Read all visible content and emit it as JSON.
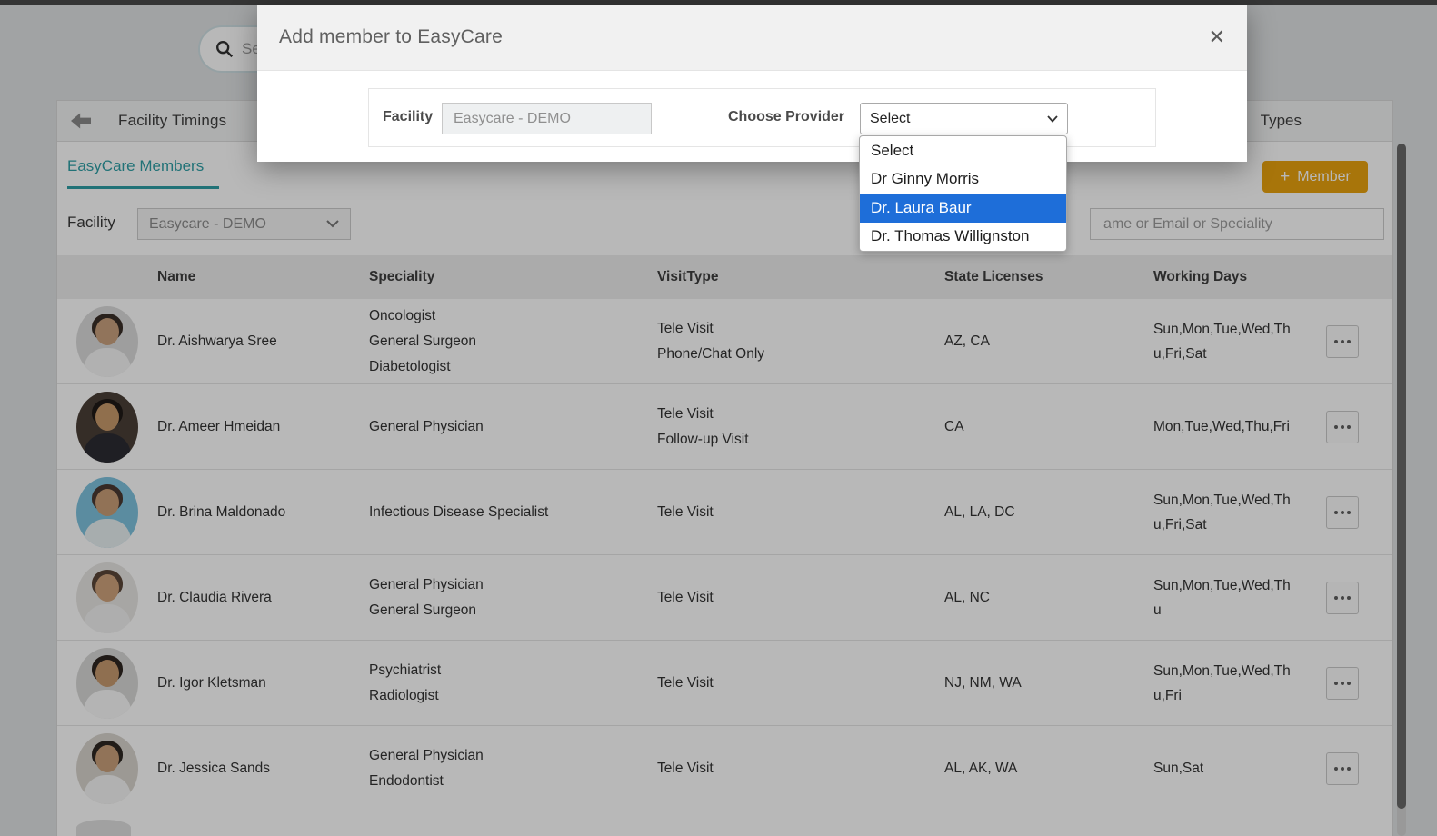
{
  "page": {
    "top_search": {
      "placeholder_visible": "Se"
    },
    "panel": {
      "back_icon": "left-arrow",
      "title": "Facility Timings",
      "right_text": "Types",
      "tab": "EasyCare Members",
      "member_button": {
        "plus": "+",
        "label": "Member",
        "color": "#e9a20f"
      },
      "facility_filter": {
        "label": "Facility",
        "value": "Easycare - DEMO"
      },
      "member_search": {
        "placeholder_visible": "ame or Email or Speciality"
      },
      "accent_teal": "#2f9fa5"
    },
    "table": {
      "headers": [
        "Name",
        "Speciality",
        "VisitType",
        "State Licenses",
        "Working Days"
      ],
      "row_action_icon": "ellipsis",
      "rows": [
        {
          "name": "Dr. Aishwarya Sree",
          "specialities": [
            "Oncologist",
            "General Surgeon",
            "Diabetologist"
          ],
          "visit_types": [
            "Tele Visit",
            "Phone/Chat Only"
          ],
          "state_licenses": "AZ, CA",
          "working_days": "Sun,Mon,Tue,Wed,Thu,Fri,Sat",
          "avatar": {
            "bg": "#dcdcdc",
            "hair": "#3a2e28",
            "skin": "#caa17e",
            "coat": "#f5f5f5"
          }
        },
        {
          "name": "Dr. Ameer Hmeidan",
          "specialities": [
            "General Physician"
          ],
          "visit_types": [
            "Tele Visit",
            "Follow-up Visit"
          ],
          "state_licenses": "CA",
          "working_days": "Mon,Tue,Wed,Thu,Fri",
          "avatar": {
            "bg": "#4a3f36",
            "hair": "#1f1a17",
            "skin": "#c89a6b",
            "coat": "#2b2b33"
          }
        },
        {
          "name": "Dr. Brina Maldonado",
          "specialities": [
            "Infectious Disease Specialist"
          ],
          "visit_types": [
            "Tele Visit"
          ],
          "state_licenses": "AL, LA, DC",
          "working_days": "Sun,Mon,Tue,Wed,Thu,Fri,Sat",
          "avatar": {
            "bg": "#7ec3de",
            "hair": "#4a3a32",
            "skin": "#c99f78",
            "coat": "#e8f0f2"
          }
        },
        {
          "name": "Dr. Claudia Rivera",
          "specialities": [
            "General Physician",
            "General Surgeon"
          ],
          "visit_types": [
            "Tele Visit"
          ],
          "state_licenses": "AL, NC",
          "working_days": "Sun,Mon,Tue,Wed,Thu",
          "avatar": {
            "bg": "#e8e6e3",
            "hair": "#5a4638",
            "skin": "#cfa27c",
            "coat": "#f2f2f2"
          }
        },
        {
          "name": "Dr. Igor Kletsman",
          "specialities": [
            "Psychiatrist",
            "Radiologist"
          ],
          "visit_types": [
            "Tele Visit"
          ],
          "state_licenses": "NJ, NM, WA",
          "working_days": "Sun,Mon,Tue,Wed,Thu,Fri",
          "avatar": {
            "bg": "#d9d9d7",
            "hair": "#2e2620",
            "skin": "#c79a70",
            "coat": "#fafafa"
          }
        },
        {
          "name": "Dr. Jessica Sands",
          "specialities": [
            "General Physician",
            "Endodontist"
          ],
          "visit_types": [
            "Tele Visit"
          ],
          "state_licenses": "AL, AK, WA",
          "working_days": "Sun,Sat",
          "avatar": {
            "bg": "#d8d4cd",
            "hair": "#2f2722",
            "skin": "#c9a07a",
            "coat": "#f5f5f5"
          }
        }
      ]
    }
  },
  "modal": {
    "title": "Add member to EasyCare",
    "close_icon": "close",
    "facility_field": {
      "label": "Facility",
      "value": "Easycare - DEMO"
    },
    "provider_field": {
      "label": "Choose Provider",
      "value": "Select"
    },
    "provider_dropdown": {
      "options": [
        "Select",
        "Dr Ginny Morris",
        "Dr. Laura Baur",
        "Dr. Thomas Willignston"
      ],
      "highlighted_index": 2,
      "highlight_color": "#1e6ed9"
    }
  }
}
